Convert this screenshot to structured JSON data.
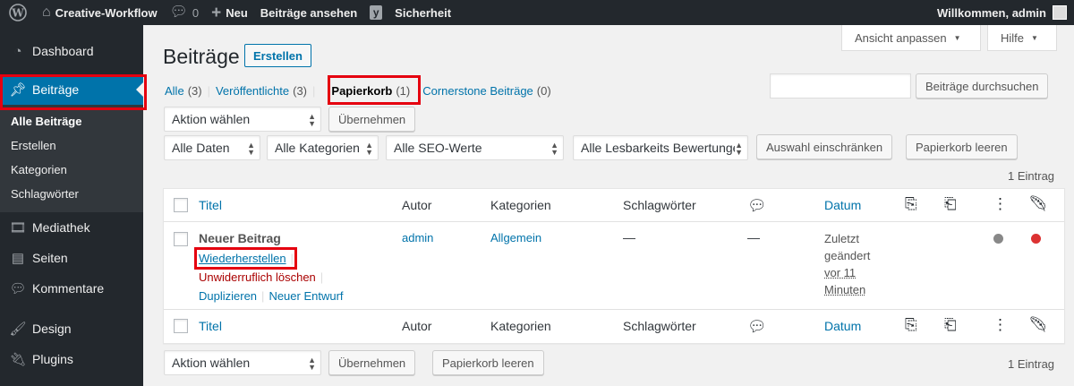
{
  "admin_bar": {
    "site_name": "Creative-Workflow",
    "comments_count": "0",
    "new_label": "Neu",
    "view_posts_label": "Beiträge ansehen",
    "security_label": "Sicherheit",
    "greeting": "Willkommen, admin"
  },
  "sidebar": {
    "dashboard": "Dashboard",
    "posts": "Beiträge",
    "submenu": [
      "Alle Beiträge",
      "Erstellen",
      "Kategorien",
      "Schlagwörter"
    ],
    "media": "Mediathek",
    "pages": "Seiten",
    "comments": "Kommentare",
    "design": "Design",
    "plugins": "Plugins"
  },
  "screen_meta": {
    "screen_options": "Ansicht anpassen",
    "help": "Hilfe"
  },
  "page": {
    "title": "Beiträge",
    "add_new": "Erstellen"
  },
  "views": [
    {
      "label": "Alle",
      "count": "(3)"
    },
    {
      "label": "Veröffentlichte",
      "count": "(3)"
    },
    {
      "label": "Papierkorb",
      "count": "(1)"
    },
    {
      "label": "Cornerstone Beiträge",
      "count": "(0)"
    }
  ],
  "search": {
    "button": "Beiträge durchsuchen"
  },
  "bulk": {
    "action_select": "Aktion wählen",
    "apply": "Übernehmen",
    "empty_trash": "Papierkorb leeren",
    "filter": "Auswahl einschränken",
    "item_count": "1 Eintrag"
  },
  "filters": {
    "dates": "Alle Daten",
    "categories": "Alle Kategorien",
    "seo": "Alle SEO-Werte",
    "readability": "Alle Lesbarkeits Bewertungen"
  },
  "table": {
    "headers": {
      "title": "Titel",
      "author": "Autor",
      "categories": "Kategorien",
      "tags": "Schlagwörter",
      "date": "Datum"
    },
    "row": {
      "title": "Neuer Beitrag",
      "author": "admin",
      "category": "Allgemein",
      "tags": "—",
      "comments": "—",
      "date_lines": [
        "Zuletzt",
        "geändert",
        "vor 11",
        "Minuten"
      ],
      "actions": {
        "restore": "Wiederherstellen",
        "delete": "Unwiderruflich löschen",
        "duplicate": "Duplizieren",
        "new_draft": "Neuer Entwurf"
      },
      "seo_dot_color": "#888888",
      "readability_dot_color": "#dc3232"
    }
  }
}
